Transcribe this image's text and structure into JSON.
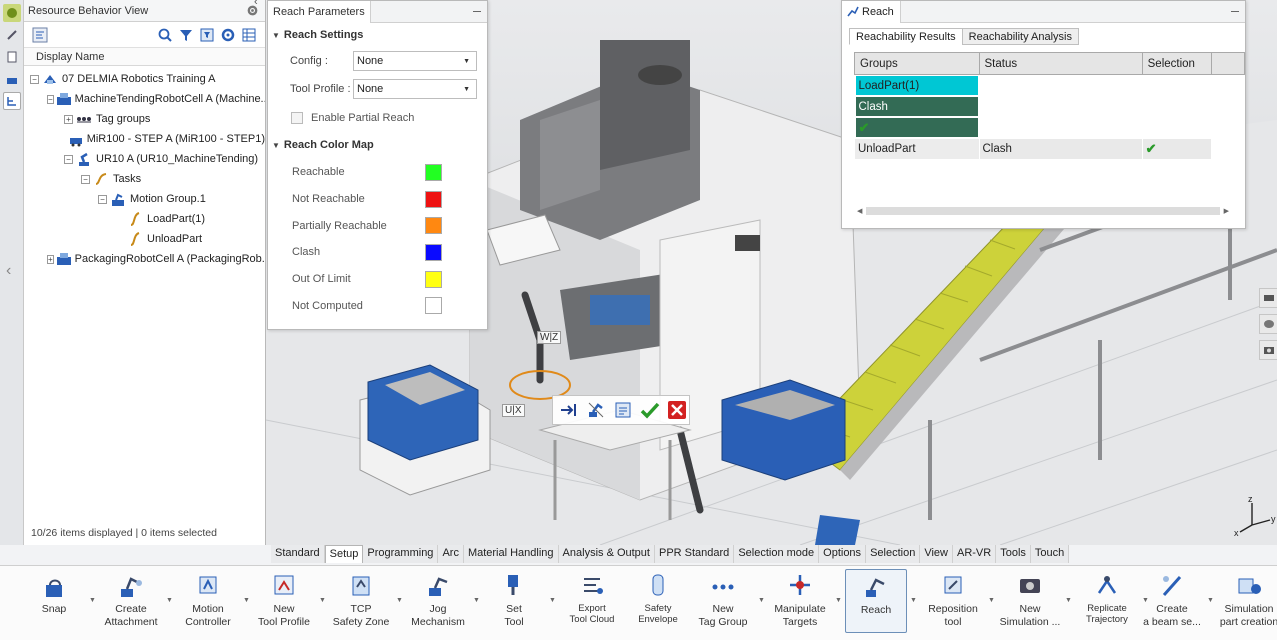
{
  "resource_view": {
    "title": "Resource Behavior View",
    "column_header": "Display Name",
    "status": "10/26 items displayed | 0 items selected",
    "tree": [
      {
        "label": "07 DELMIA Robotics Training A",
        "depth": 0,
        "expander": "−",
        "icon": "robotics-root-icon"
      },
      {
        "label": "MachineTendingRobotCell A (Machine...",
        "depth": 1,
        "expander": "−",
        "icon": "robot-cell-icon"
      },
      {
        "label": "Tag groups",
        "depth": 2,
        "expander": "+",
        "icon": "tag-groups-icon"
      },
      {
        "label": "MiR100 - STEP A (MiR100 - STEP1)",
        "depth": 2,
        "expander": "",
        "icon": "mobile-robot-icon"
      },
      {
        "label": "UR10 A (UR10_MachineTending)",
        "depth": 2,
        "expander": "−",
        "icon": "robot-arm-icon"
      },
      {
        "label": "Tasks",
        "depth": 3,
        "expander": "−",
        "icon": "tasks-icon"
      },
      {
        "label": "Motion Group.1",
        "depth": 4,
        "expander": "−",
        "icon": "motion-group-icon"
      },
      {
        "label": "LoadPart(1)",
        "depth": 5,
        "expander": "",
        "icon": "trajectory-icon"
      },
      {
        "label": "UnloadPart",
        "depth": 5,
        "expander": "",
        "icon": "trajectory-icon"
      },
      {
        "label": "PackagingRobotCell A (PackagingRob...",
        "depth": 1,
        "expander": "+",
        "icon": "robot-cell-icon"
      }
    ]
  },
  "reach_params": {
    "tab": "Reach Parameters",
    "settings_header": "Reach Settings",
    "config_label": "Config :",
    "config_value": "None",
    "tool_profile_label": "Tool Profile :",
    "tool_profile_value": "None",
    "partial_reach_label": "Enable Partial Reach",
    "color_map_header": "Reach Color Map",
    "colors": [
      {
        "label": "Reachable",
        "color": "#22ff22"
      },
      {
        "label": "Not Reachable",
        "color": "#ee1111"
      },
      {
        "label": "Partially Reachable",
        "color": "#ff8811"
      },
      {
        "label": "Clash",
        "color": "#0a0aff"
      },
      {
        "label": "Out Of Limit",
        "color": "#ffff11"
      },
      {
        "label": "Not Computed",
        "color": "#ffffff"
      }
    ]
  },
  "reach": {
    "tab": "Reach",
    "tabs": [
      "Reachability Results",
      "Reachability Analysis"
    ],
    "columns": [
      "Groups",
      "Status",
      "Selection"
    ],
    "rows": [
      {
        "group": "LoadPart(1)",
        "status": "Clash",
        "selected": true
      },
      {
        "group": "UnloadPart",
        "status": "Clash",
        "selected": false
      }
    ]
  },
  "axes": {
    "wz": "W|Z",
    "ux": "U|X"
  },
  "action_tabs": [
    "Standard",
    "Setup",
    "Programming",
    "Arc",
    "Material Handling",
    "Analysis & Output",
    "PPR Standard",
    "Selection mode",
    "Options",
    "Selection",
    "View",
    "AR-VR",
    "Tools",
    "Touch"
  ],
  "active_action_tab": "Setup",
  "commands": [
    {
      "label": "Snap",
      "icon": "snap-icon"
    },
    {
      "label": "Create\nAttachment",
      "icon": "attachment-icon"
    },
    {
      "label": "Motion\nController",
      "icon": "motion-controller-icon"
    },
    {
      "label": "New\nTool Profile",
      "icon": "tool-profile-icon"
    },
    {
      "label": "TCP\nSafety Zone",
      "icon": "safety-zone-icon"
    },
    {
      "label": "Jog\nMechanism",
      "icon": "jog-icon"
    },
    {
      "label": "Set\nTool",
      "icon": "set-tool-icon"
    },
    {
      "label": "Export\nTool Cloud",
      "icon": "export-cloud-icon",
      "small": true
    },
    {
      "label": "Safety\nEnvelope",
      "icon": "safety-envelope-icon",
      "small": true
    },
    {
      "label": "New\nTag Group",
      "icon": "tag-group-icon"
    },
    {
      "label": "Manipulate\nTargets",
      "icon": "manipulate-icon"
    },
    {
      "label": "Reach",
      "icon": "reach-icon",
      "active": true
    },
    {
      "label": "Reposition\ntool",
      "icon": "reposition-icon"
    },
    {
      "label": "New\nSimulation ...",
      "icon": "simulation-icon"
    },
    {
      "label": "Replicate\nTrajectory",
      "icon": "replicate-icon",
      "small": true
    },
    {
      "label": "Create\na beam se...",
      "icon": "beam-icon"
    },
    {
      "label": "Simulation\npart creation",
      "icon": "part-creation-icon"
    }
  ]
}
